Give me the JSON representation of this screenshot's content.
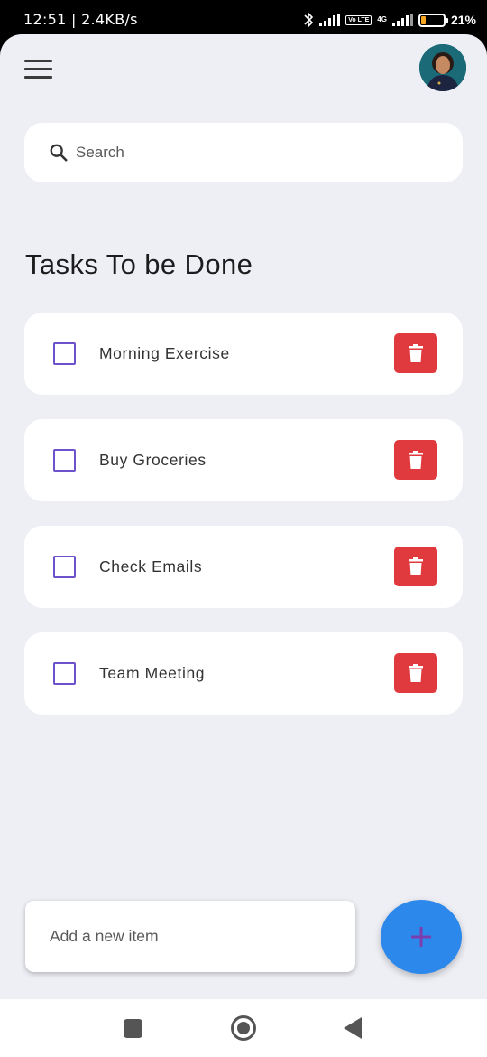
{
  "status_bar": {
    "time_speed": "12:51 | 2.4KB/s",
    "volte": "Vo LTE",
    "network": "4G",
    "battery_level": 0.21,
    "battery_text": "21%"
  },
  "header": {
    "menu_icon": "hamburger-menu-icon",
    "avatar": "user-avatar"
  },
  "search": {
    "icon": "search-icon",
    "placeholder": "Search"
  },
  "title": "Tasks To be Done",
  "tasks": [
    {
      "label": "Morning Exercise",
      "checked": false
    },
    {
      "label": "Buy Groceries",
      "checked": false
    },
    {
      "label": "Check Emails",
      "checked": false
    },
    {
      "label": "Team Meeting",
      "checked": false
    }
  ],
  "add_item": {
    "placeholder": "Add a new item",
    "button_icon": "plus-icon"
  },
  "colors": {
    "background": "#eeeff5",
    "checkbox": "#6e52cb",
    "delete": "#e0393e",
    "fab": "#2d88eb",
    "fab_plus": "#7a3fae"
  },
  "nav": {
    "recent_icon": "recent-apps-icon",
    "home_icon": "home-icon",
    "back_icon": "back-icon"
  }
}
